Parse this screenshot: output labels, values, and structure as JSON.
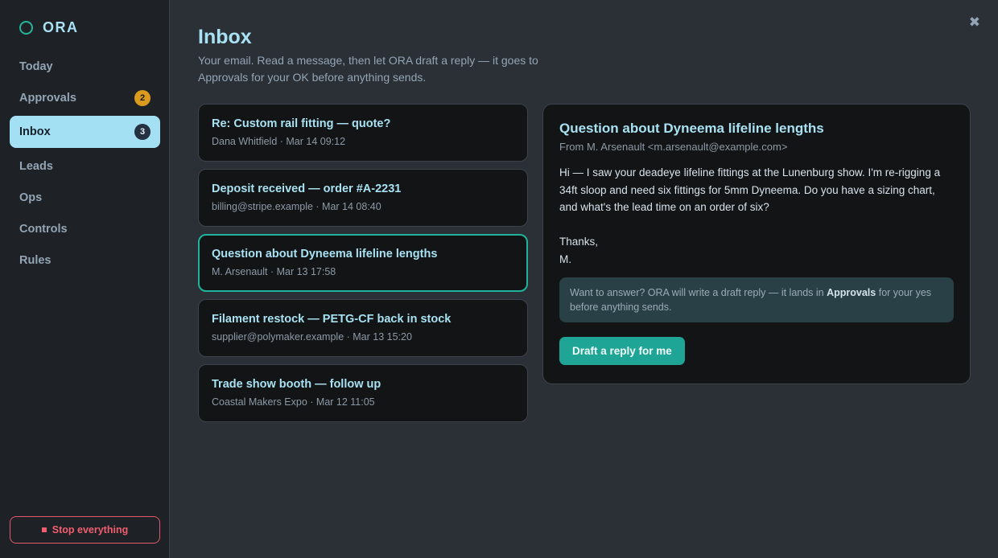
{
  "app": {
    "name": "ORA"
  },
  "sidebar": {
    "items": [
      {
        "label": "Today"
      },
      {
        "label": "Approvals",
        "badge": "2"
      },
      {
        "label": "Inbox",
        "badge": "3",
        "active": true
      },
      {
        "label": "Leads"
      },
      {
        "label": "Ops"
      },
      {
        "label": "Controls"
      },
      {
        "label": "Rules"
      }
    ],
    "stop_label": "Stop everything"
  },
  "page": {
    "title": "Inbox",
    "subtitle": "Your email. Read a message, then let ORA draft a reply — it goes to Approvals for your OK before anything sends.",
    "close_icon": "close-icon"
  },
  "messages": [
    {
      "subject": "Re: Custom rail fitting — quote?",
      "meta": "Dana Whitfield · Mar 14 09:12"
    },
    {
      "subject": "Deposit received — order #A-2231",
      "meta": "billing@stripe.example · Mar 14 08:40"
    },
    {
      "subject": "Question about Dyneema lifeline lengths",
      "meta": "M. Arsenault · Mar 13 17:58",
      "selected": true
    },
    {
      "subject": "Filament restock — PETG-CF back in stock",
      "meta": "supplier@polymaker.example · Mar 13 15:20"
    },
    {
      "subject": "Trade show booth — follow up",
      "meta": "Coastal Makers Expo · Mar 12 11:05"
    }
  ],
  "detail": {
    "subject": "Question about Dyneema lifeline lengths",
    "from": "From M. Arsenault <m.arsenault@example.com>",
    "body": "Hi — I saw your deadeye lifeline fittings at the Lunenburg show. I'm re-rigging a 34ft sloop and need six fittings for 5mm Dyneema. Do you have a sizing chart, and what's the lead time on an order of six?\n\nThanks,\nM.",
    "hint_pre": "Want to answer? ORA will write a draft reply — it lands in ",
    "hint_bold": "Approvals",
    "hint_post": " for your yes before anything sends.",
    "draft_button": "Draft a reply for me"
  },
  "colors": {
    "accent": "#1fb39b",
    "title": "#a8e2f2",
    "badge_amber": "#d99a1e",
    "danger": "#f05e6f"
  }
}
